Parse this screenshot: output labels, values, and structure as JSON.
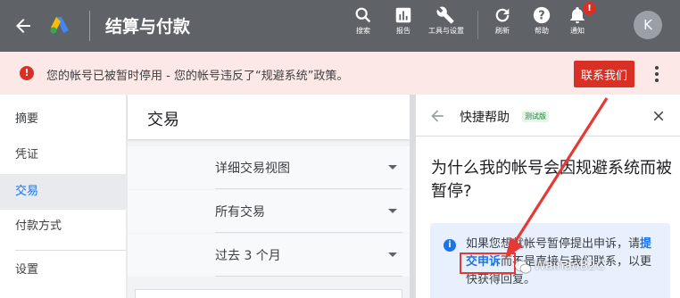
{
  "header": {
    "title": "结算与付款",
    "tools": [
      {
        "label": "搜索",
        "icon": "search-icon"
      },
      {
        "label": "报告",
        "icon": "reports-icon"
      },
      {
        "label": "工具与设置",
        "icon": "wrench-icon"
      },
      {
        "label": "刷新",
        "icon": "refresh-icon"
      },
      {
        "label": "帮助",
        "icon": "help-icon"
      },
      {
        "label": "通知",
        "icon": "bell-icon"
      }
    ],
    "notification_badge": "!",
    "avatar_initial": "K"
  },
  "alert": {
    "message": "您的帐号已被暂时停用 - 您的帐号违反了“规避系统”政策。",
    "button_label": "联系我们"
  },
  "nav": {
    "items": [
      {
        "label": "摘要",
        "active": false
      },
      {
        "label": "凭证",
        "active": false
      },
      {
        "label": "交易",
        "active": true
      },
      {
        "label": "付款方式",
        "active": false
      },
      {
        "label": "设置",
        "active": false
      }
    ]
  },
  "main": {
    "title": "交易",
    "filters": [
      "详细交易视图",
      "所有交易",
      "过去 3 个月"
    ]
  },
  "help": {
    "title": "快捷帮助",
    "badge": "测试版",
    "question": "为什么我的帐号会因规避系统而被暂停?",
    "info_prefix": "如果您想就帐号暂停提出申诉，请",
    "info_link": "提交申诉",
    "info_suffix": "而不是直接与我们联系，以更快获得回复。"
  },
  "watermark": "WainaoB2C",
  "colors": {
    "topbar": "#5f6368",
    "alert_bg": "#fce8e6",
    "danger": "#d93025",
    "link": "#1a73e8",
    "annotation": "#e53935"
  }
}
